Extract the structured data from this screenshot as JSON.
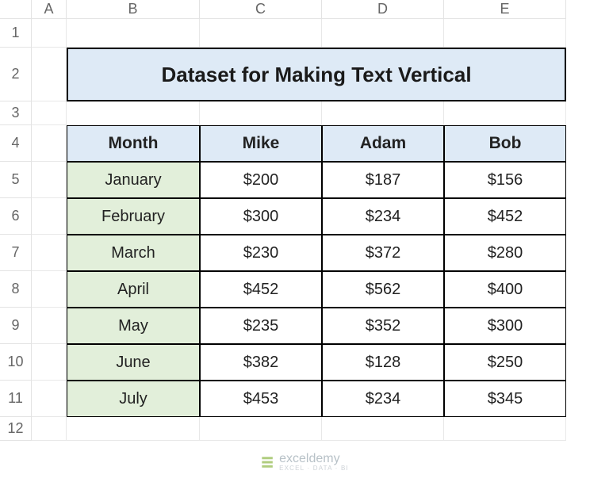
{
  "columns": [
    "A",
    "B",
    "C",
    "D",
    "E"
  ],
  "rows": [
    "1",
    "2",
    "3",
    "4",
    "5",
    "6",
    "7",
    "8",
    "9",
    "10",
    "11",
    "12"
  ],
  "title": "Dataset for Making Text Vertical",
  "headers": {
    "month": "Month",
    "c1": "Mike",
    "c2": "Adam",
    "c3": "Bob"
  },
  "dataRows": [
    {
      "month": "January",
      "mike": "$200",
      "adam": "$187",
      "bob": "$156"
    },
    {
      "month": "February",
      "mike": "$300",
      "adam": "$234",
      "bob": "$452"
    },
    {
      "month": "March",
      "mike": "$230",
      "adam": "$372",
      "bob": "$280"
    },
    {
      "month": "April",
      "mike": "$452",
      "adam": "$562",
      "bob": "$400"
    },
    {
      "month": "May",
      "mike": "$235",
      "adam": "$352",
      "bob": "$300"
    },
    {
      "month": "June",
      "mike": "$382",
      "adam": "$128",
      "bob": "$250"
    },
    {
      "month": "July",
      "mike": "$453",
      "adam": "$234",
      "bob": "$345"
    }
  ],
  "watermark": {
    "brand": "exceldemy",
    "tagline": "EXCEL · DATA · BI"
  }
}
